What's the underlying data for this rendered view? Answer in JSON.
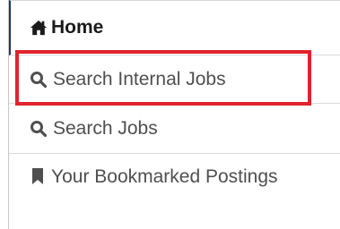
{
  "nav": {
    "home": {
      "label": "Home",
      "icon": "home-icon"
    },
    "search_internal_jobs": {
      "label": "Search Internal Jobs",
      "icon": "search-icon"
    },
    "search_jobs": {
      "label": "Search Jobs",
      "icon": "search-icon"
    },
    "bookmarked_postings": {
      "label": "Your Bookmarked Postings",
      "icon": "bookmark-icon"
    }
  },
  "colors": {
    "home_accent": "#1f3a5f",
    "highlight": "#e0232c",
    "text": "#4f4f4f"
  }
}
